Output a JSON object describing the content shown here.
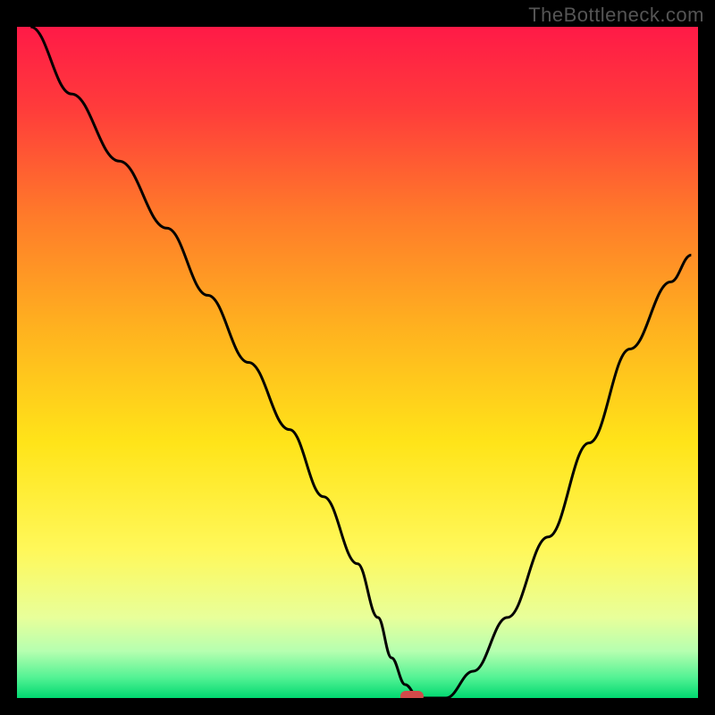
{
  "watermark": "TheBottleneck.com",
  "chart_data": {
    "type": "line",
    "title": "",
    "xlabel": "",
    "ylabel": "",
    "xlim": [
      0,
      100
    ],
    "ylim": [
      0,
      100
    ],
    "grid": false,
    "background_gradient": [
      {
        "stop": 0.0,
        "color": "#ff1a47"
      },
      {
        "stop": 0.12,
        "color": "#ff3b3b"
      },
      {
        "stop": 0.28,
        "color": "#ff7a2a"
      },
      {
        "stop": 0.45,
        "color": "#ffb21f"
      },
      {
        "stop": 0.62,
        "color": "#ffe419"
      },
      {
        "stop": 0.78,
        "color": "#fff85a"
      },
      {
        "stop": 0.88,
        "color": "#e8ff9a"
      },
      {
        "stop": 0.93,
        "color": "#b6ffb0"
      },
      {
        "stop": 0.97,
        "color": "#52f293"
      },
      {
        "stop": 1.0,
        "color": "#00d870"
      }
    ],
    "series": [
      {
        "name": "bottleneck-curve",
        "x": [
          2,
          8,
          15,
          22,
          28,
          34,
          40,
          45,
          50,
          53,
          55,
          57,
          59,
          63,
          67,
          72,
          78,
          84,
          90,
          96,
          99
        ],
        "y": [
          100,
          90,
          80,
          70,
          60,
          50,
          40,
          30,
          20,
          12,
          6,
          2,
          0,
          0,
          4,
          12,
          24,
          38,
          52,
          62,
          66
        ]
      }
    ],
    "marker": {
      "name": "optimal-point",
      "x": 58,
      "y": 0,
      "color": "#d24a4a",
      "shape": "rounded-rect"
    }
  }
}
